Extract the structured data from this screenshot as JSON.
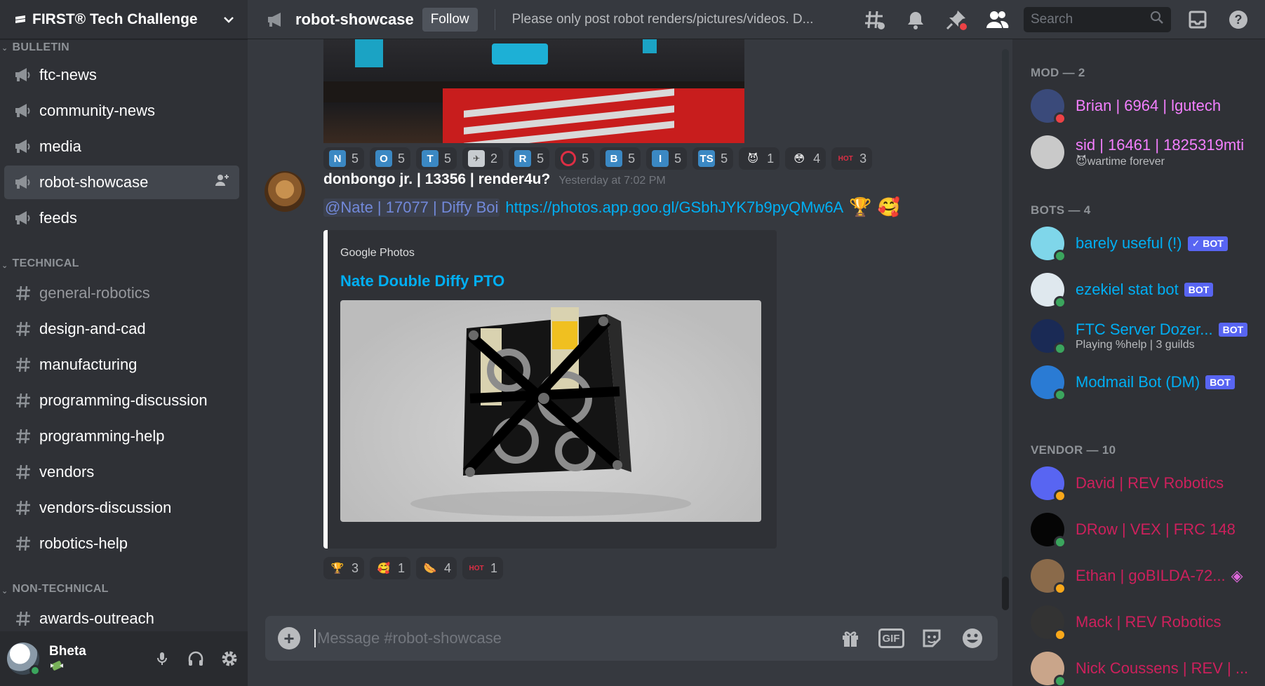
{
  "guild": {
    "name": "FIRST® Tech Challenge"
  },
  "sidebar": {
    "categories": [
      {
        "name": "BULLETIN",
        "channels": [
          {
            "name": "ftc-news",
            "type": "announcement"
          },
          {
            "name": "community-news",
            "type": "announcement"
          },
          {
            "name": "media",
            "type": "announcement"
          },
          {
            "name": "robot-showcase",
            "type": "announcement",
            "active": true
          },
          {
            "name": "feeds",
            "type": "announcement"
          }
        ]
      },
      {
        "name": "TECHNICAL",
        "channels": [
          {
            "name": "general-robotics",
            "type": "text",
            "muted": true
          },
          {
            "name": "design-and-cad",
            "type": "text"
          },
          {
            "name": "manufacturing",
            "type": "text"
          },
          {
            "name": "programming-discussion",
            "type": "text"
          },
          {
            "name": "programming-help",
            "type": "text"
          },
          {
            "name": "vendors",
            "type": "text"
          },
          {
            "name": "vendors-discussion",
            "type": "text"
          },
          {
            "name": "robotics-help",
            "type": "text"
          }
        ]
      },
      {
        "name": "NON-TECHNICAL",
        "channels": [
          {
            "name": "awards-outreach",
            "type": "text"
          }
        ]
      }
    ]
  },
  "user": {
    "name": "Bheta",
    "status_emoji": "money-wings"
  },
  "header": {
    "channel": "robot-showcase",
    "follow_label": "Follow",
    "topic": "Please only post robot renders/pictures/videos. D...",
    "search_placeholder": "Search"
  },
  "top_reactions": [
    {
      "emoji": "N",
      "style": "blue",
      "count": "5"
    },
    {
      "emoji": "O",
      "style": "blue",
      "count": "5"
    },
    {
      "emoji": "T",
      "style": "blue",
      "count": "5"
    },
    {
      "emoji": "✈",
      "style": "gray",
      "count": "2"
    },
    {
      "emoji": "R",
      "style": "blue",
      "count": "5"
    },
    {
      "emoji": "",
      "style": "red-ring",
      "count": "5"
    },
    {
      "emoji": "B",
      "style": "blue",
      "count": "5"
    },
    {
      "emoji": "I",
      "style": "blue",
      "count": "5"
    },
    {
      "emoji": "TS",
      "style": "blue",
      "count": "5"
    },
    {
      "emoji": "😈",
      "style": "plain",
      "count": "1"
    },
    {
      "emoji": "😳",
      "style": "plain",
      "count": "4"
    },
    {
      "emoji": "HOT",
      "style": "hot",
      "count": "3"
    }
  ],
  "message": {
    "author": "donbongo jr. | 13356 | render4u?",
    "timestamp": "Yesterday at 7:02 PM",
    "mention": "@Nate | 17077 | Diffy Boi",
    "link": "https://photos.app.goo.gl/GSbhJYK7b9pyQMw6A",
    "trailing_emojis": [
      "🏆",
      "🥰"
    ],
    "embed": {
      "provider": "Google Photos",
      "title": "Nate Double Diffy PTO"
    },
    "reactions": [
      {
        "emoji": "🏆",
        "count": "3"
      },
      {
        "emoji": "🥰",
        "count": "1"
      },
      {
        "emoji": "🌭",
        "count": "4"
      },
      {
        "emoji": "HOT",
        "style": "hot",
        "count": "1"
      }
    ]
  },
  "composer": {
    "placeholder": "Message #robot-showcase",
    "gif_label": "GIF"
  },
  "members": {
    "groups": [
      {
        "title": "MOD — 2",
        "role": "mod",
        "items": [
          {
            "name": "Brian | 6964 | lgutech",
            "status": "dnd",
            "avatar_color": "#3a4a7a"
          },
          {
            "name": "sid | 16461 | 1825319mti",
            "status": "none",
            "sub": "wartime forever",
            "sub_emoji": "😈",
            "avatar_color": "#c9c9c9"
          }
        ]
      },
      {
        "title": "BOTS — 4",
        "role": "bot",
        "items": [
          {
            "name": "barely useful (!)",
            "status": "online",
            "badge": "✓ BOT",
            "avatar_color": "#7fd6ea"
          },
          {
            "name": "ezekiel stat bot",
            "status": "online",
            "badge": "BOT",
            "avatar_color": "#dfe8ee"
          },
          {
            "name": "FTC Server Dozer...",
            "status": "online",
            "badge": "BOT",
            "sub": "Playing %help | 3 guilds",
            "avatar_color": "#1a2a55"
          },
          {
            "name": "Modmail Bot (DM)",
            "status": "online",
            "badge": "BOT",
            "avatar_color": "#2a7bd4"
          }
        ]
      },
      {
        "title": "VENDOR — 10",
        "role": "vendor",
        "items": [
          {
            "name": "David | REV Robotics",
            "status": "idle",
            "avatar_color": "#5865f2"
          },
          {
            "name": "DRow | VEX | FRC 148",
            "status": "online",
            "avatar_color": "#050505"
          },
          {
            "name": "Ethan | goBILDA-72...",
            "status": "idle",
            "avatar_color": "#8a6a4a",
            "trailing": "◈"
          },
          {
            "name": "Mack | REV Robotics",
            "status": "idle",
            "avatar_color": "#333333"
          },
          {
            "name": "Nick Coussens | REV | ...",
            "status": "online",
            "avatar_color": "#c9a58a"
          }
        ]
      }
    ]
  }
}
